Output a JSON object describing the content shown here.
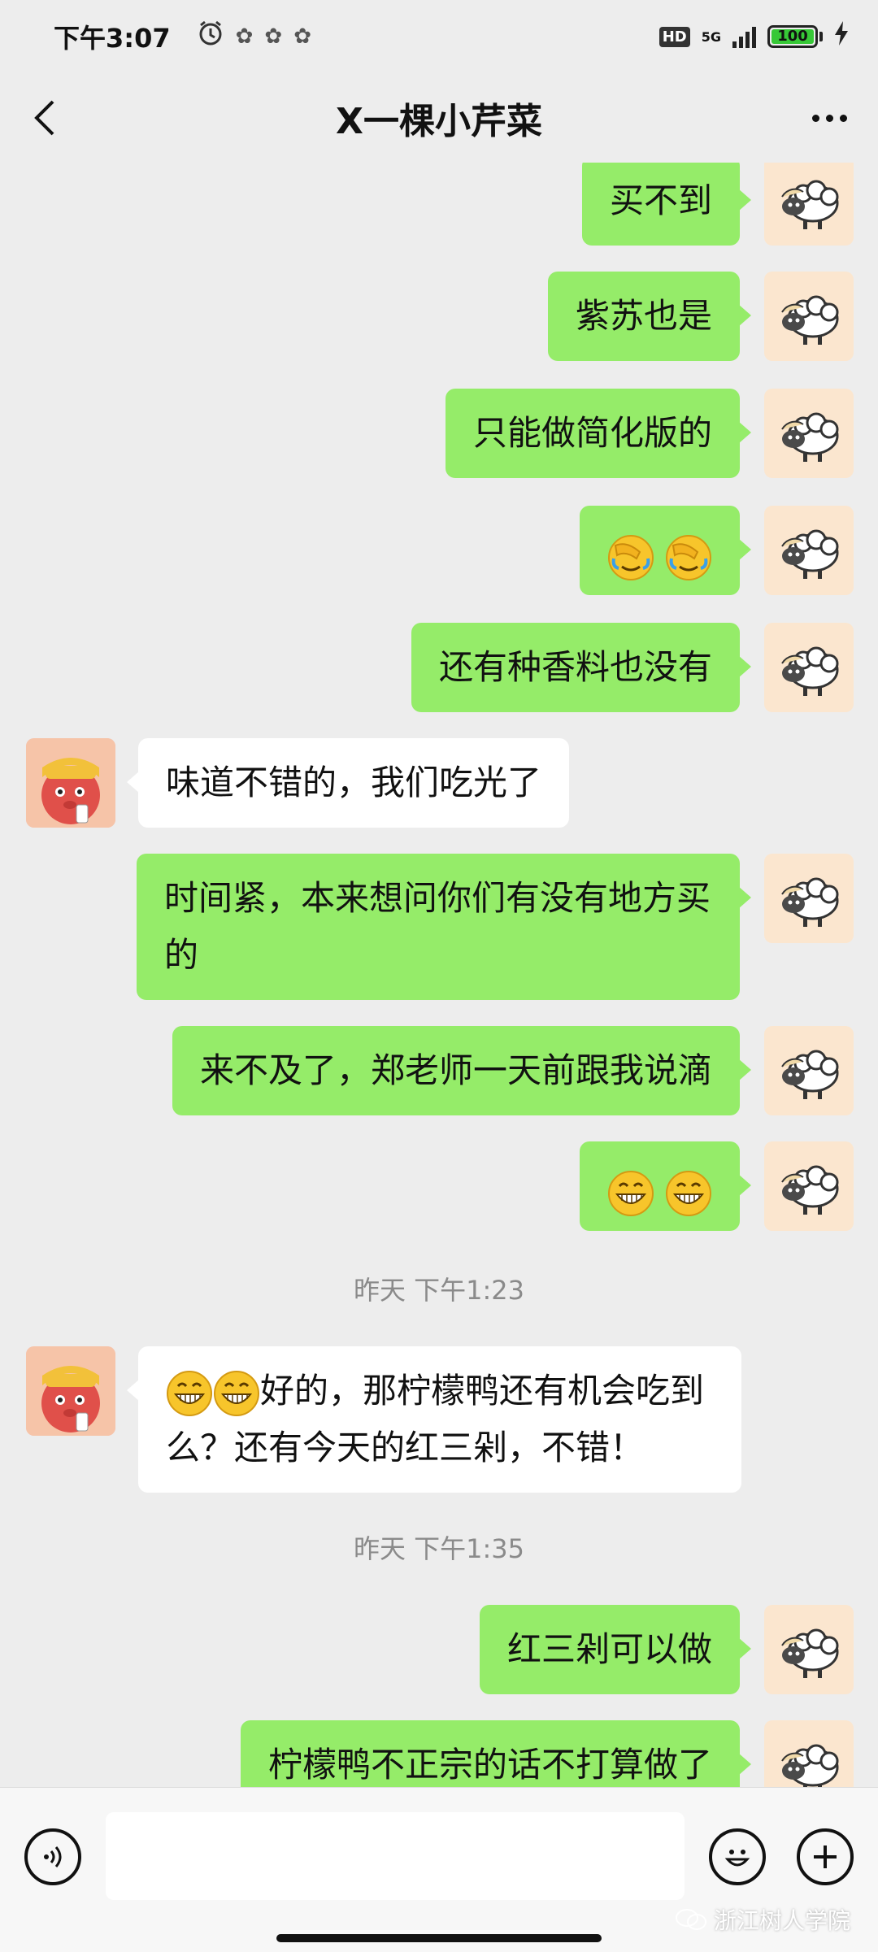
{
  "status_bar": {
    "time": "下午3:07",
    "hd": "HD",
    "network": "5G",
    "battery": "100"
  },
  "header": {
    "title": "X一棵小芹菜"
  },
  "messages": [
    {
      "side": "self",
      "text": "买不到"
    },
    {
      "side": "self",
      "text": "紫苏也是"
    },
    {
      "side": "self",
      "text": "只能做简化版的"
    },
    {
      "side": "self",
      "text": "",
      "emojis": [
        "facepalm",
        "facepalm"
      ]
    },
    {
      "side": "self",
      "text": "还有种香料也没有"
    },
    {
      "side": "other",
      "text": "味道不错的，我们吃光了"
    },
    {
      "side": "self",
      "text": "时间紧，本来想问你们有没有地方买的"
    },
    {
      "side": "self",
      "text": "来不及了，郑老师一天前跟我说滴"
    },
    {
      "side": "self",
      "text": "",
      "emojis": [
        "grin",
        "grin"
      ]
    },
    {
      "side": "other",
      "text": "好的，那柠檬鸭还有机会吃到么？还有今天的红三剁，不错！",
      "emojis": [
        "grin",
        "grin"
      ]
    },
    {
      "side": "self",
      "text": "红三剁可以做"
    },
    {
      "side": "self",
      "text": "柠檬鸭不正宗的话不打算做了"
    }
  ],
  "timestamps": [
    "昨天 下午1:23",
    "昨天 下午1:35"
  ],
  "input_bar": {
    "placeholder": ""
  },
  "watermark": "浙江树人学院",
  "colors": {
    "self_bubble": "#95ec69",
    "other_bubble": "#ffffff",
    "background": "#ededed"
  }
}
